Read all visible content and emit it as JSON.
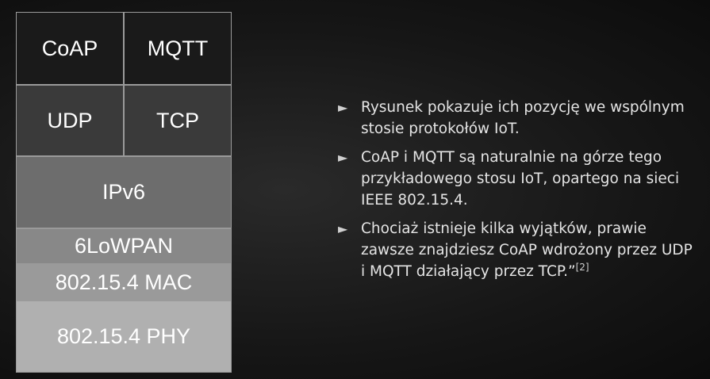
{
  "stack": {
    "coap": "CoAP",
    "mqtt": "MQTT",
    "udp": "UDP",
    "tcp": "TCP",
    "ipv6": "IPv6",
    "lowpan": "6LoWPAN",
    "mac": "802.15.4 MAC",
    "phy": "802.15.4 PHY"
  },
  "bullets": [
    {
      "text": "Rysunek pokazuje ich pozycję we wspólnym stosie protokołów IoT."
    },
    {
      "text": "CoAP i MQTT są naturalnie na górze tego przykładowego stosu IoT, opartego na sieci IEEE 802.15.4."
    },
    {
      "text": "Chociaż istnieje kilka wyjątków, prawie zawsze znajdziesz CoAP wdrożony przez UDP i MQTT działający przez TCP.”",
      "citation": "[2]"
    }
  ],
  "colors": {
    "layer_app": "#1a1a1a",
    "layer_transport": "#3a3a3a",
    "layer_ipv6": "#6d6d6d",
    "layer_6lowpan": "#888888",
    "layer_mac": "#9a9a9a",
    "layer_phy": "#b0b0b0"
  }
}
